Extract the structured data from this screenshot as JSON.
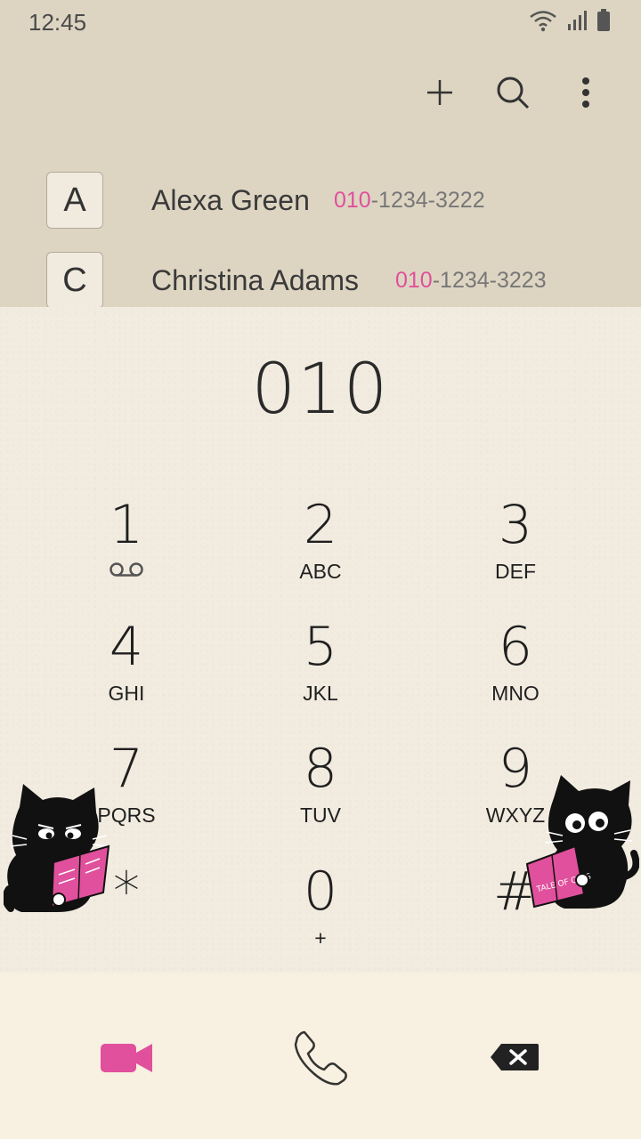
{
  "status_bar": {
    "time": "12:45"
  },
  "toolbar": {
    "add_icon": "plus-icon",
    "search_icon": "search-icon",
    "more_icon": "more-vertical-icon"
  },
  "contacts": [
    {
      "letter": "A",
      "name": "Alexa Green",
      "phone_match": "010",
      "phone_rest": "-1234-3222"
    },
    {
      "letter": "C",
      "name": "Christina Adams",
      "phone_match": "010",
      "phone_rest": "-1234-3223"
    }
  ],
  "dialer": {
    "number": "010",
    "keys": [
      {
        "digit": "1",
        "letters": ""
      },
      {
        "digit": "2",
        "letters": "ABC"
      },
      {
        "digit": "3",
        "letters": "DEF"
      },
      {
        "digit": "4",
        "letters": "GHI"
      },
      {
        "digit": "5",
        "letters": "JKL"
      },
      {
        "digit": "6",
        "letters": "MNO"
      },
      {
        "digit": "7",
        "letters": "PQRS"
      },
      {
        "digit": "8",
        "letters": "TUV"
      },
      {
        "digit": "9",
        "letters": "WXYZ"
      },
      {
        "digit": "*",
        "letters": ""
      },
      {
        "digit": "0",
        "letters": "+"
      },
      {
        "digit": "#",
        "letters": ""
      }
    ],
    "book_title": "TALE OF CATS"
  },
  "colors": {
    "accent": "#e0509c",
    "header_bg": "#ddd5c2",
    "dialer_bg": "#f2ece0",
    "bottom_bg": "#f8f0e0"
  }
}
